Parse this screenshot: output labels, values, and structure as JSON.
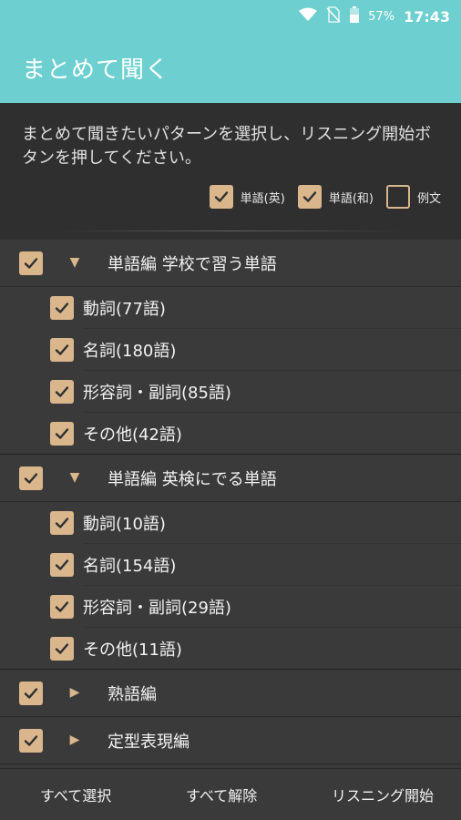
{
  "status_bar": {
    "battery": "57%",
    "time": "17:43"
  },
  "app_title": "まとめて聞く",
  "intro": {
    "text": "まとめて聞きたいパターンを選択し、リスニング開始ボタンを押してください。",
    "options": [
      {
        "label": "単語(英)",
        "checked": true
      },
      {
        "label": "単語(和)",
        "checked": true
      },
      {
        "label": "例文",
        "checked": false
      }
    ]
  },
  "groups": [
    {
      "label": "単語編 学校で習う単語",
      "checked": true,
      "expanded": true,
      "items": [
        {
          "label": "動詞(77語)",
          "checked": true
        },
        {
          "label": "名詞(180語)",
          "checked": true
        },
        {
          "label": "形容詞・副詞(85語)",
          "checked": true
        },
        {
          "label": "その他(42語)",
          "checked": true
        }
      ]
    },
    {
      "label": "単語編 英検にでる単語",
      "checked": true,
      "expanded": true,
      "items": [
        {
          "label": "動詞(10語)",
          "checked": true
        },
        {
          "label": "名詞(154語)",
          "checked": true
        },
        {
          "label": "形容詞・副詞(29語)",
          "checked": true
        },
        {
          "label": "その他(11語)",
          "checked": true
        }
      ]
    },
    {
      "label": "熟語編",
      "checked": true,
      "expanded": false,
      "items": []
    },
    {
      "label": "定型表現編",
      "checked": true,
      "expanded": false,
      "items": []
    }
  ],
  "footer": {
    "select_all": "すべて選択",
    "deselect_all": "すべて解除",
    "start_listening": "リスニング開始"
  },
  "colors": {
    "header": "#6dcfcf",
    "checkbox": "#d9b68c",
    "background": "#3a3a3a"
  }
}
